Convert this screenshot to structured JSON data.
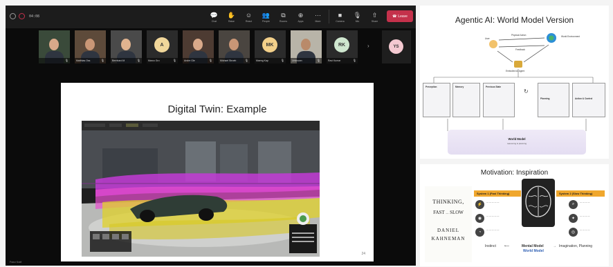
{
  "toolbar": {
    "timer": "04:08",
    "buttons": [
      {
        "label": "Chat",
        "icon": "chat-icon",
        "glyph": "💬"
      },
      {
        "label": "Raise",
        "icon": "raise-hand-icon",
        "glyph": "✋"
      },
      {
        "label": "React",
        "icon": "react-icon",
        "glyph": "☺"
      },
      {
        "label": "People",
        "icon": "people-icon",
        "glyph": "👥"
      },
      {
        "label": "Rooms",
        "icon": "rooms-icon",
        "glyph": "⧉"
      },
      {
        "label": "Apps",
        "icon": "apps-icon",
        "glyph": "⊕"
      },
      {
        "label": "More",
        "icon": "more-icon",
        "glyph": "···"
      },
      {
        "label": "Camera",
        "icon": "camera-icon",
        "glyph": "■"
      },
      {
        "label": "Mic",
        "icon": "mic-icon",
        "glyph": "🎙"
      },
      {
        "label": "Share",
        "icon": "share-icon",
        "glyph": "⇧"
      }
    ],
    "leave": {
      "label": "Leave",
      "color": "#c4314b"
    }
  },
  "participants": [
    {
      "name": "",
      "initials": "",
      "kind": "video",
      "bg": "#3a4a3a"
    },
    {
      "name": "Matthias Oss",
      "initials": "",
      "kind": "video",
      "bg": "#5d4a3a"
    },
    {
      "name": "Bernhard M",
      "initials": "",
      "kind": "video",
      "bg": "#4a4a4a"
    },
    {
      "name": "Marco Gro",
      "initials": "A",
      "kind": "avatar",
      "bg": "#f1d79a"
    },
    {
      "name": "Andre Gle",
      "initials": "",
      "kind": "video",
      "bg": "#4d3b32"
    },
    {
      "name": "Michael Stroeb",
      "initials": "",
      "kind": "video",
      "bg": "#4a4540"
    },
    {
      "name": "Maeng Kap",
      "initials": "MK",
      "kind": "avatar",
      "bg": "#f3d08a"
    },
    {
      "name": "Unknown",
      "initials": "",
      "kind": "video",
      "bg": "#b8b4a8"
    },
    {
      "name": "Ravi Kumar",
      "initials": "RK",
      "kind": "avatar",
      "bg": "#cfe7cf"
    }
  ],
  "extra_participant": {
    "initials": "YS",
    "bg": "#f4c9d1"
  },
  "shared_slide": {
    "title": "Digital Twin: Example",
    "page": "24"
  },
  "viewer_label": "Franz Kraft",
  "slide_agentic": {
    "title": "Agentic AI: World Model Version",
    "labels": {
      "user": "User",
      "physical_action": "Physical Action",
      "world_env": "World Environment",
      "feedback": "Feedback",
      "embodied": "Embodied AI Agent",
      "perception": "Perception",
      "memory": "Memory",
      "previous_state": "Previous State",
      "planning": "Planning",
      "action_control": "Action & Control",
      "world_model": "World Model",
      "world_model_sub": "reasoning & planning"
    }
  },
  "slide_motivation": {
    "title": "Motivation: Inspiration",
    "book": [
      "THINKING,",
      "FAST",
      "SLOW",
      "DANIEL",
      "KAHNEMAN"
    ],
    "system1": "System 1 (Fast Thinking)",
    "system2": "System 2 (Slow Thinking)",
    "instinct": "Instinct",
    "mental_model": "Mental Model",
    "world_model": "World Model",
    "imagination": "Imagination, Planning"
  },
  "colors": {
    "accent_orange": "#f0a72d",
    "leave_red": "#c4314b",
    "flow_purple": "#c23bd6",
    "flow_yellow": "#e0d229"
  }
}
